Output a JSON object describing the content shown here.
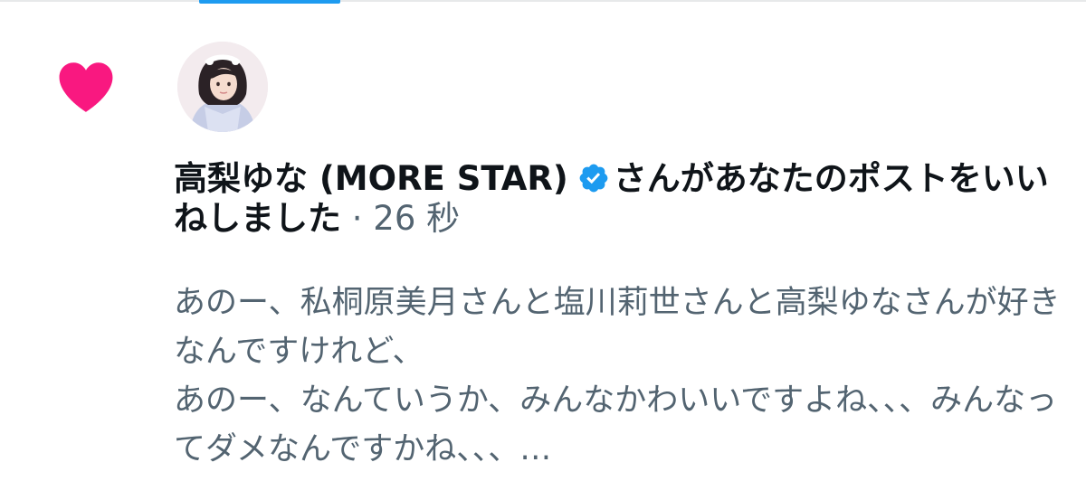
{
  "notification": {
    "user_name": "高梨ゆな (MORE STAR)",
    "action_text": "さんがあなたのポストをいいねしました",
    "separator": "·",
    "timestamp": "26 秒",
    "post_preview": "あのー、私桐原美月さんと塩川莉世さんと高梨ゆなさんが好きなんですけれど、\nあのー、なんていうか、みんなかわいいですよね、、、みんなってダメなんですかね、、、…",
    "icons": {
      "notification_type": "heart-icon",
      "verified": "verified-badge-icon"
    }
  },
  "colors": {
    "heart": "#f91880",
    "verified": "#1d9bf0",
    "tab_indicator": "#1d9bf0",
    "primary_text": "#0f1419",
    "secondary_text": "#536471"
  }
}
